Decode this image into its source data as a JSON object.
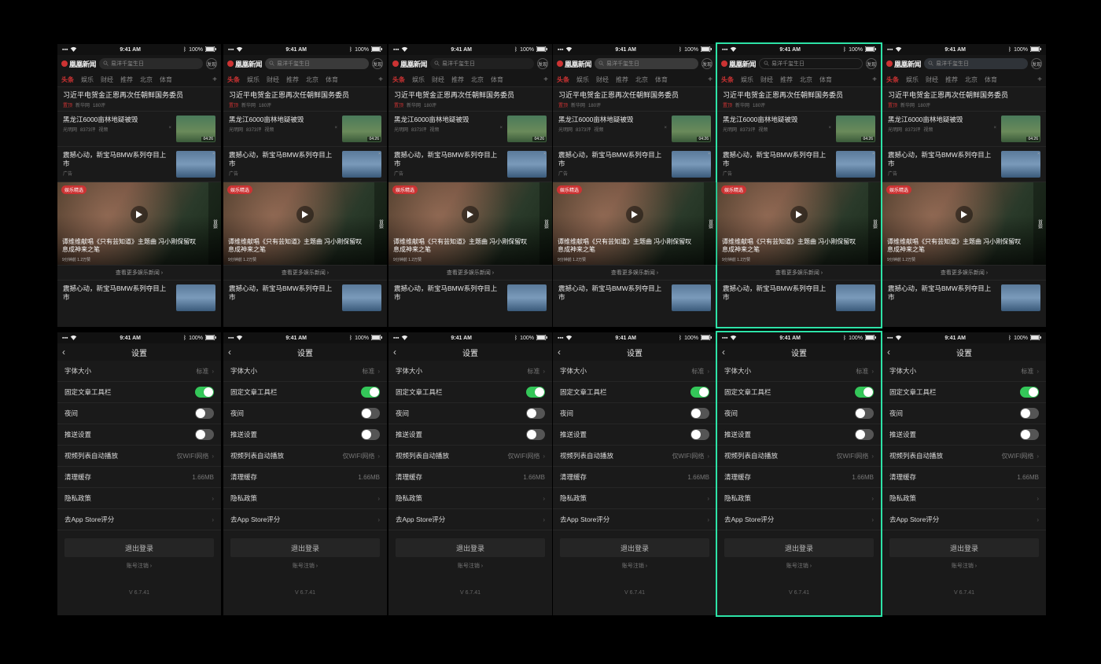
{
  "status_bar": {
    "time": "9:41 AM",
    "bt": "100%"
  },
  "feed": {
    "brand": "凰凰新闻",
    "search_placeholder": "易洋千玺生日",
    "publish_icon_glyph": "发现",
    "tabs": [
      "头条",
      "娱乐",
      "财经",
      "推荐",
      "北京",
      "体育"
    ],
    "active_tab_index": 0,
    "top_article": {
      "title": "习近平电贺金正恩再次任朝鲜国务委员",
      "tag": "置顶",
      "source": "新华网",
      "comments": "180评"
    },
    "a2": {
      "title": "黑龙江6000亩林地疑被毁",
      "source": "光明网",
      "comments": "8373评",
      "extra": "视频",
      "duration": "04:26"
    },
    "a3": {
      "title": "震撼心动，新宝马BMW系列夺目上市",
      "ad_tag": "广告"
    },
    "video": {
      "badge": "娱乐精选",
      "title": "谭维维献唱《只有芸知道》主题曲 冯小刚保留叹息成神来之笔",
      "meta": "9分钟前  1.2万赞",
      "side_label": "首察"
    },
    "more_link": "查看更多娱乐新闻 ›",
    "a4": {
      "title": "震撼心动，新宝马BMW系列夺目上市"
    }
  },
  "settings": {
    "title": "设置",
    "rows": {
      "font_size": {
        "label": "字体大小",
        "value": "标准"
      },
      "fixed_bar": {
        "label": "固定文章工具栏",
        "on": true
      },
      "night": {
        "label": "夜间",
        "on": false
      },
      "push": {
        "label": "推送设置",
        "on": false
      },
      "autoplay": {
        "label": "视频列表自动播放",
        "value": "仅WIFI网络"
      },
      "cache": {
        "label": "清理缓存",
        "value": "1.66MB"
      },
      "privacy": {
        "label": "隐私政策"
      },
      "rate": {
        "label": "去App Store评分"
      }
    },
    "logout": "退出登录",
    "deactivate": "账号注销 ›",
    "version": "V 6.7.41"
  },
  "search_variants": [
    "search-bg-dark",
    "search-bg-light",
    "search-bg-darker",
    "search-bg-light",
    "search-bg-stroke",
    "search-bg-tinted"
  ],
  "selected_column": 4
}
